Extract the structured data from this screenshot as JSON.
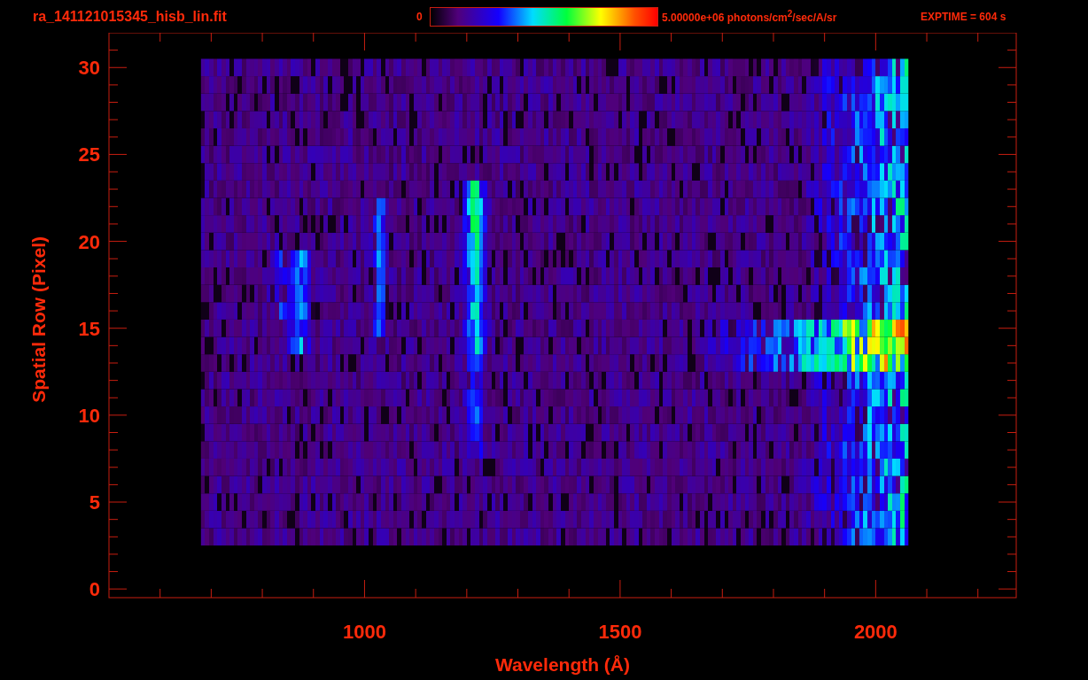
{
  "header": {
    "file_name": "ra_141121015345_hisb_lin.fit",
    "colorbar_min": "0",
    "colorbar_max": "5.00000e+06 photons/cm$^{2}$/sec/A/sr",
    "exposure": "EXPTIME = 604 s"
  },
  "plot": {
    "xlabel": "Wavelength (Å)",
    "ylabel": "Spatial Row (Pixel)",
    "xticks": [
      "1000",
      "1500",
      "2000"
    ],
    "yticks": [
      "30",
      "25",
      "20",
      "15",
      "10",
      "5",
      "0"
    ]
  }
}
